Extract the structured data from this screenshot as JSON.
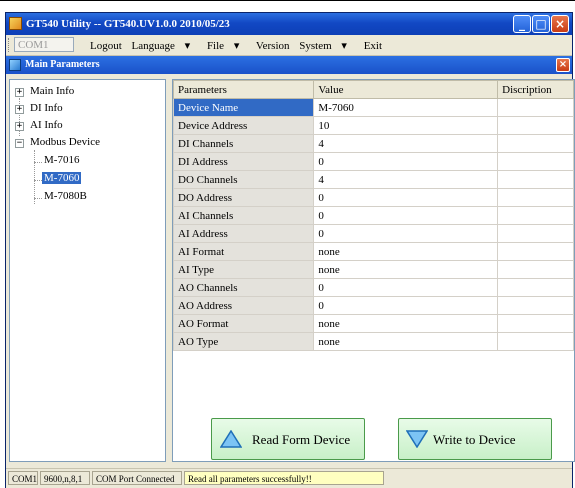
{
  "window": {
    "title": "GT540 Utility -- GT540.UV1.0.0 2010/05/23",
    "minimize_glyph": "_",
    "maximize_glyph": "□",
    "close_glyph": "×"
  },
  "toolbar": {
    "port_value": "COM1",
    "menu": [
      "Logout",
      "Language",
      "File",
      "Version",
      "System",
      "Exit"
    ]
  },
  "subwindow": {
    "title": "Main Parameters",
    "close_glyph": "×"
  },
  "tree": {
    "items": [
      {
        "label": "Main Info",
        "expander": "+"
      },
      {
        "label": "DI Info",
        "expander": "+"
      },
      {
        "label": "AI Info",
        "expander": "+"
      },
      {
        "label": "Modbus Device",
        "expander": "−"
      }
    ],
    "children": [
      "M-7016",
      "M-7060",
      "M-7080B"
    ],
    "selected_child": "M-7060"
  },
  "table": {
    "headers": [
      "Parameters",
      "Value",
      "Discription"
    ],
    "rows": [
      {
        "name": "Device Name",
        "value": "M-7060",
        "desc": ""
      },
      {
        "name": "Device Address",
        "value": "10",
        "desc": ""
      },
      {
        "name": "DI Channels",
        "value": "4",
        "desc": ""
      },
      {
        "name": "DI Address",
        "value": "0",
        "desc": ""
      },
      {
        "name": "DO Channels",
        "value": "4",
        "desc": ""
      },
      {
        "name": "DO Address",
        "value": "0",
        "desc": ""
      },
      {
        "name": "AI Channels",
        "value": "0",
        "desc": ""
      },
      {
        "name": "AI Address",
        "value": "0",
        "desc": ""
      },
      {
        "name": "AI Format",
        "value": "none",
        "desc": ""
      },
      {
        "name": "AI Type",
        "value": "none",
        "desc": ""
      },
      {
        "name": "AO Channels",
        "value": "0",
        "desc": ""
      },
      {
        "name": "AO Address",
        "value": "0",
        "desc": ""
      },
      {
        "name": "AO Format",
        "value": "none",
        "desc": ""
      },
      {
        "name": "AO Type",
        "value": "none",
        "desc": ""
      }
    ],
    "selected_row": 0
  },
  "buttons": {
    "read_label": "Read Form Device",
    "write_label": "Write to Device"
  },
  "statusbar": {
    "port": "COM1",
    "settings": "9600,n,8,1",
    "connection": "COM Port Connected",
    "message": "Read all parameters successfully!!"
  },
  "colors": {
    "title_blue": "#1248c4",
    "selection": "#316ac5",
    "button_green": "#c8f0c8",
    "status_yellow": "#ffffc0"
  },
  "icons": {
    "app": "app-icon",
    "up_arrow": "up-arrow-icon",
    "down_arrow": "down-arrow-icon"
  }
}
